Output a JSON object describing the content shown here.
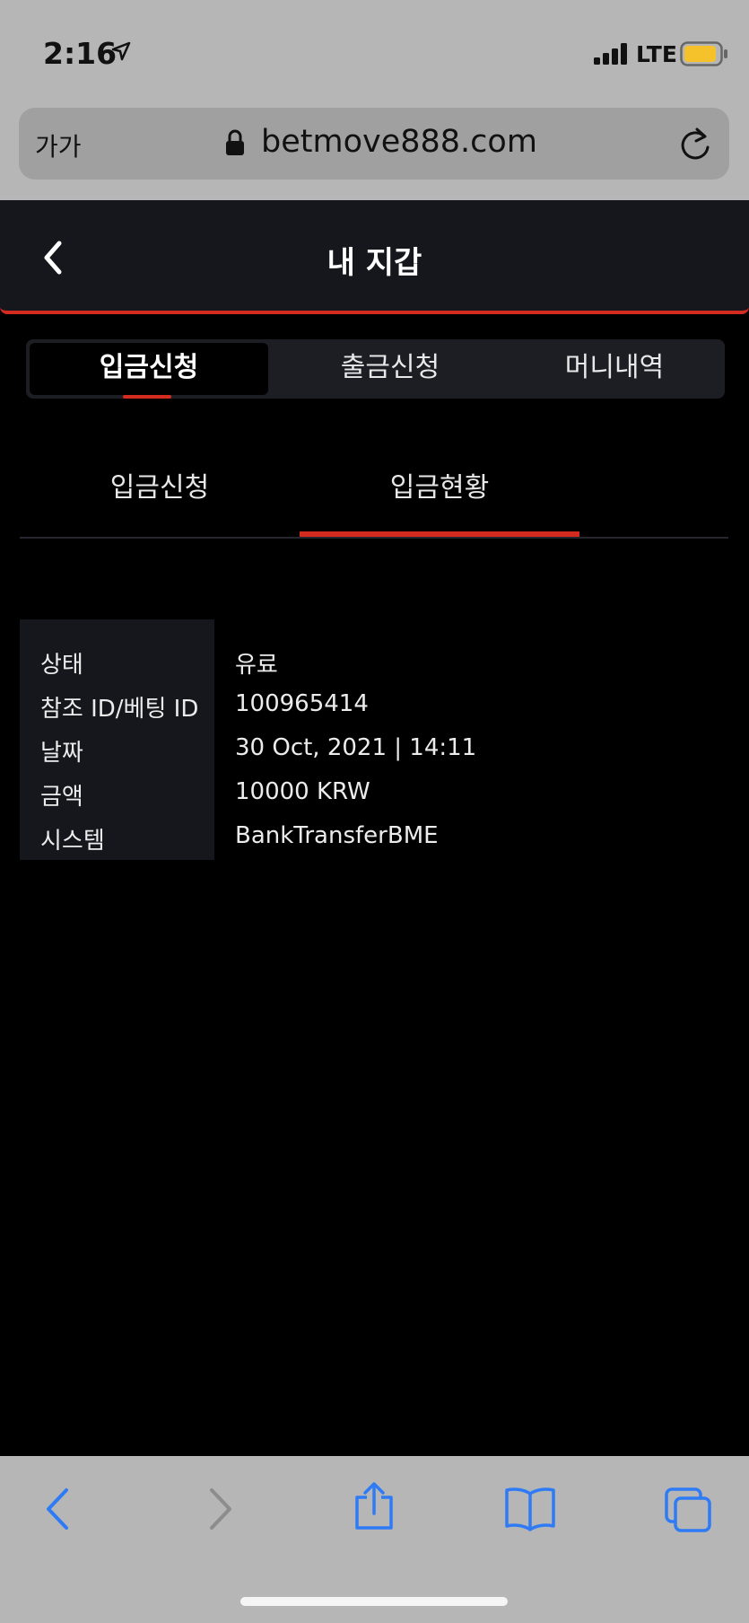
{
  "status_bar": {
    "time": "2:16",
    "network": "LTE"
  },
  "browser": {
    "text_size_label": "가가",
    "url": "betmove888.com"
  },
  "header": {
    "title": "내 지갑"
  },
  "tabs": [
    {
      "label": "입금신청",
      "active": true
    },
    {
      "label": "출금신청",
      "active": false
    },
    {
      "label": "머니내역",
      "active": false
    }
  ],
  "subtabs": [
    {
      "label": "입금신청",
      "active": false
    },
    {
      "label": "입금현황",
      "active": true
    }
  ],
  "details": [
    {
      "label": "상태",
      "value": "유료"
    },
    {
      "label": "참조 ID/베팅 ID",
      "value": "100965414"
    },
    {
      "label": "날짜",
      "value": "30 Oct, 2021 | 14:11"
    },
    {
      "label": "금액",
      "value": "10000 KRW"
    },
    {
      "label": "시스템",
      "value": "BankTransferBME"
    }
  ],
  "colors": {
    "accent": "#d42b20",
    "ios_blue": "#2f7bf6",
    "battery": "#f5c22b"
  },
  "toolbar_icons": [
    "back-icon",
    "forward-icon",
    "share-icon",
    "bookmarks-icon",
    "tabs-icon"
  ]
}
